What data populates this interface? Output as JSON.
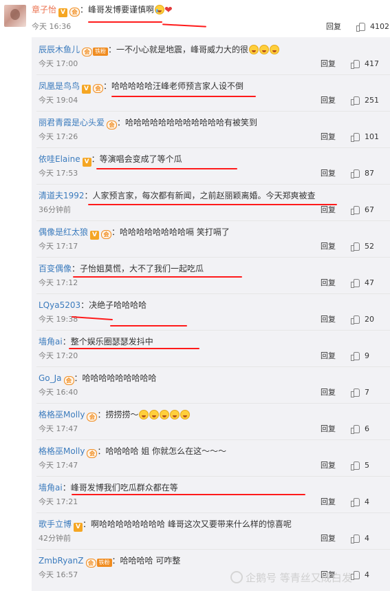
{
  "reply_label": "回复",
  "main_comment": {
    "username": "章子怡",
    "text": "：峰哥发博要谨慎啊",
    "time": "今天 16:36",
    "likes": "4102"
  },
  "replies": [
    {
      "user": "辰辰木鱼儿",
      "text": "：一不小心就是地震，峰哥威力大的很",
      "time": "今天 17:00",
      "likes": "417"
    },
    {
      "user": "凤凰是鸟鸟",
      "text": "：哈哈哈哈哈汪峰老师预言家人设不倒",
      "time": "今天 19:04",
      "likes": "251"
    },
    {
      "user": "丽君青霞是心头爱",
      "text": "：哈哈哈哈哈哈哈哈哈哈哈哈有被笑到",
      "time": "今天 17:26",
      "likes": "101"
    },
    {
      "user": "依哇Elaine",
      "text": "：等演唱会变成了等个瓜",
      "time": "今天 17:53",
      "likes": "87"
    },
    {
      "user": "清道夫1992",
      "text": "：人家预言家，每次都有新闻，之前赵丽颖离婚。今天郑爽被查",
      "time": "36分钟前",
      "likes": "67"
    },
    {
      "user": "偶像是红太狼",
      "text": "：哈哈哈哈哈哈哈哈嗝 笑打嗝了",
      "time": "今天 17:17",
      "likes": "52"
    },
    {
      "user": "百变偶像",
      "text": "：子怡姐莫慌，大不了我们一起吃瓜",
      "time": "今天 17:12",
      "likes": "47"
    },
    {
      "user": "LQya5203",
      "text": "：决绝子哈哈哈哈",
      "time": "今天 19:38",
      "likes": "20"
    },
    {
      "user": "墙角ai",
      "text": "：整个娱乐圈瑟瑟发抖中",
      "time": "今天 17:20",
      "likes": "9"
    },
    {
      "user": "Go_Ja",
      "text": "：哈哈哈哈哈哈哈哈哈",
      "time": "今天 16:40",
      "likes": "7"
    },
    {
      "user": "格格巫Molly",
      "text": "：捞捞捞～",
      "time": "今天 17:47",
      "likes": "6"
    },
    {
      "user": "格格巫Molly",
      "text": "：哈哈哈哈  姐  你就怎么在这～～～",
      "time": "今天 17:47",
      "likes": "5"
    },
    {
      "user": "墙角ai",
      "text": "：峰哥发博我们吃瓜群众都在等",
      "time": "今天 17:21",
      "likes": "4"
    },
    {
      "user": "歌手立博",
      "text": "：啊哈哈哈哈哈哈哈哈  峰哥这次又要带来什么样的惊喜呢",
      "time": "42分钟前",
      "likes": "4"
    },
    {
      "user": "ZmbRyanZ",
      "text": "：哈哈哈哈  可咋整",
      "time": "今天 16:57",
      "likes": "4"
    }
  ],
  "badges": {
    "vip": "会",
    "fan": "铁粉",
    "verified": "V"
  },
  "watermark": "企鹅号 等青丝又成白发",
  "colors": {
    "username": "#eb7350",
    "link": "#3b7bbd",
    "annotation_red": "#ff1a1a",
    "sub_bg": "#f2f2f5"
  }
}
